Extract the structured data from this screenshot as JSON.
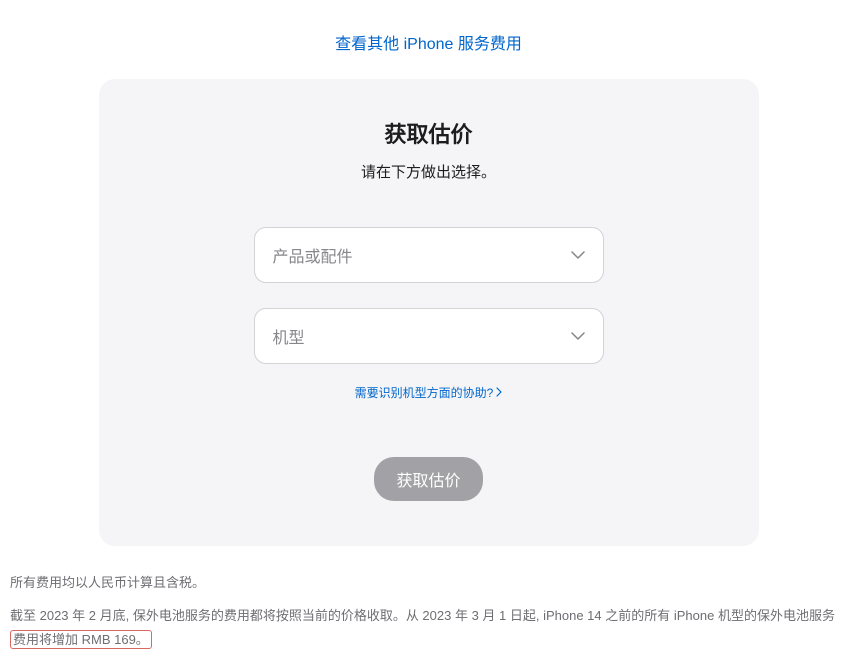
{
  "topLink": {
    "label": "查看其他 iPhone 服务费用"
  },
  "card": {
    "title": "获取估价",
    "subtitle": "请在下方做出选择。",
    "select1": {
      "placeholder": "产品或配件"
    },
    "select2": {
      "placeholder": "机型"
    },
    "helpLink": {
      "label": "需要识别机型方面的协助?"
    },
    "submitButton": {
      "label": "获取估价"
    }
  },
  "footer": {
    "line1": "所有费用均以人民币计算且含税。",
    "line2_part1": "截至 2023 年 2 月底, 保外电池服务的费用都将按照当前的价格收取。从 2023 年 3 月 1 日起, iPhone 14 之前的所有 iPhone 机型的保外电池服务",
    "line2_highlight": "费用将增加 RMB 169。"
  }
}
